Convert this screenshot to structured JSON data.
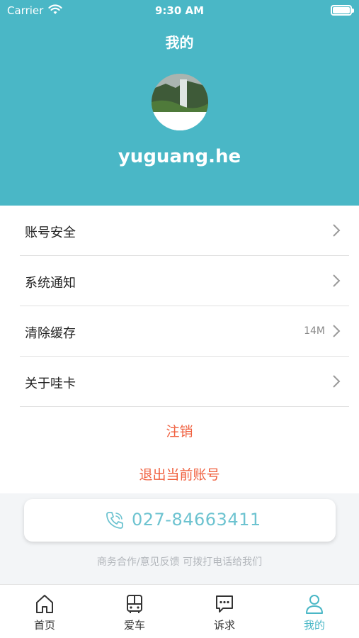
{
  "status_bar": {
    "carrier": "Carrier",
    "time": "9:30 AM"
  },
  "header": {
    "title": "我的",
    "username": "yuguang.he"
  },
  "menu": {
    "items": [
      {
        "label": "账号安全",
        "value": ""
      },
      {
        "label": "系统通知",
        "value": ""
      },
      {
        "label": "清除缓存",
        "value": "14M"
      },
      {
        "label": "关于哇卡",
        "value": ""
      }
    ]
  },
  "actions": {
    "deregister": "注销",
    "logout": "退出当前账号"
  },
  "contact": {
    "phone": "027-84663411",
    "note": "商务合作/意见反馈 可拨打电话给我们"
  },
  "tabbar": {
    "tabs": [
      {
        "label": "首页",
        "icon": "home-icon"
      },
      {
        "label": "爱车",
        "icon": "bus-icon"
      },
      {
        "label": "诉求",
        "icon": "chat-icon"
      },
      {
        "label": "我的",
        "icon": "person-icon"
      }
    ],
    "active_index": 3
  },
  "colors": {
    "accent": "#4ab7c6",
    "danger": "#f0603f",
    "phone": "#6dc3d0"
  }
}
